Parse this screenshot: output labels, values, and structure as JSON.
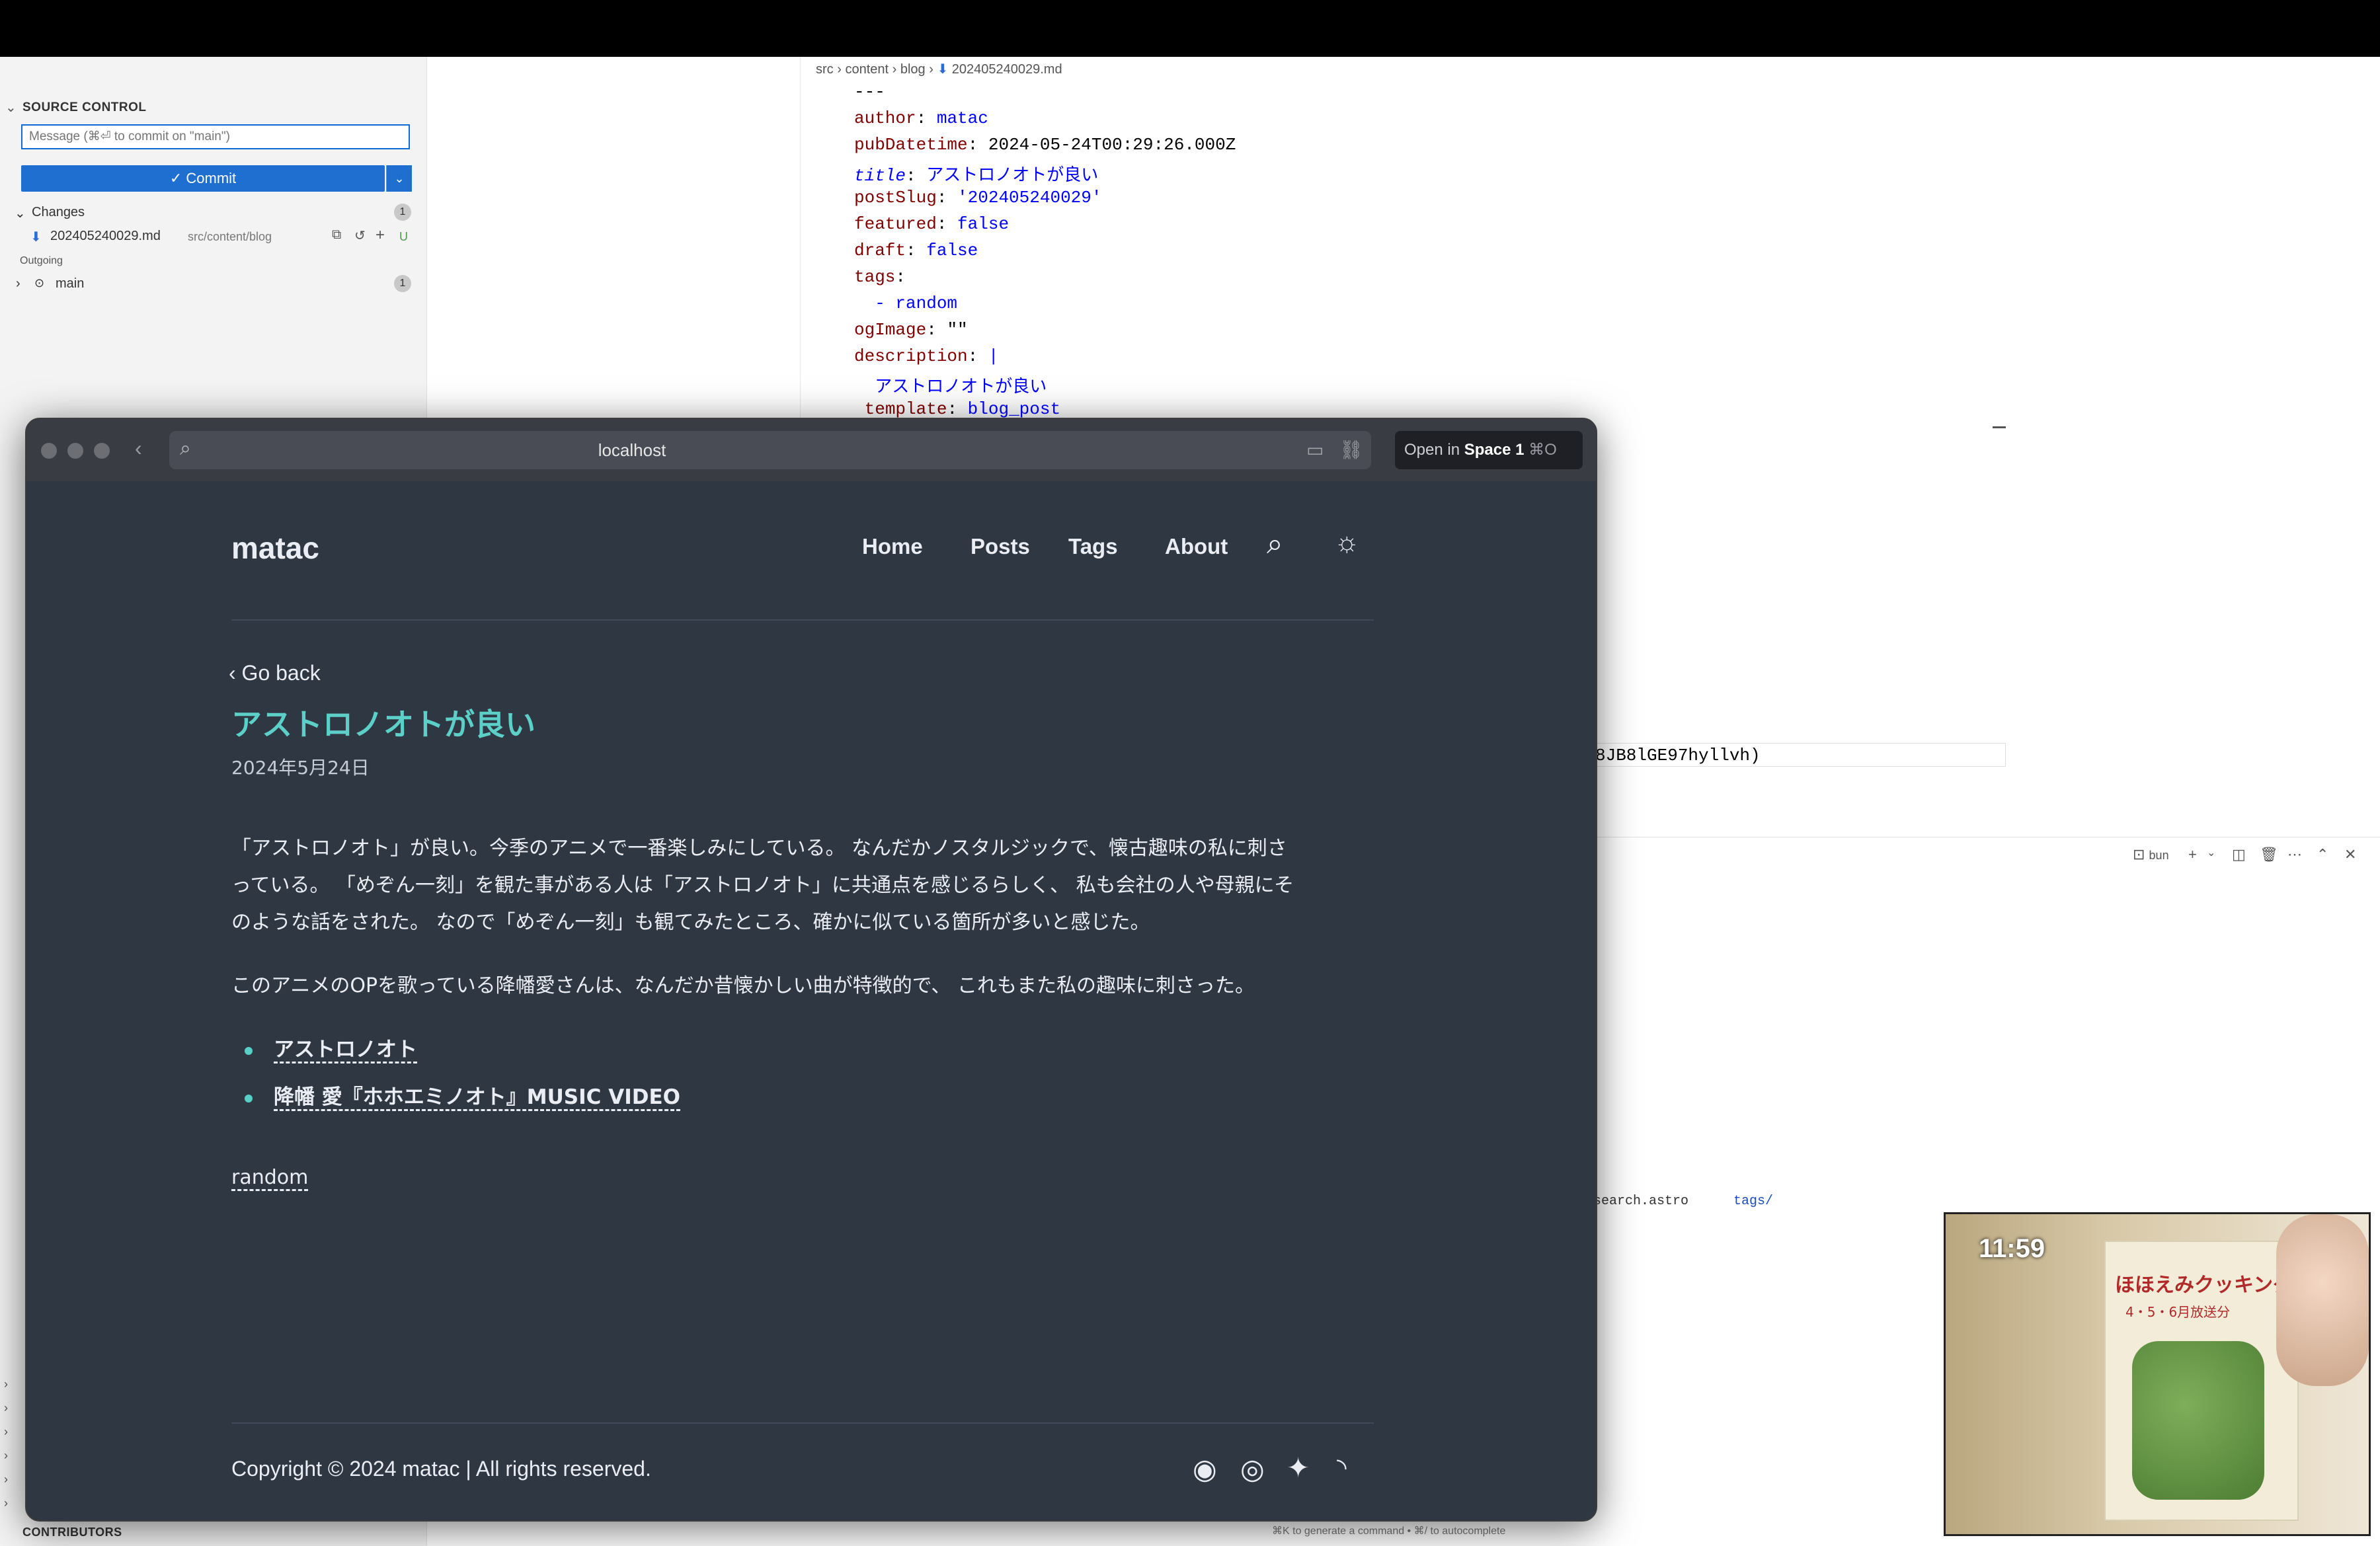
{
  "vscode": {
    "source_control": {
      "header": "SOURCE CONTROL",
      "message_placeholder": "Message (⌘⏎ to commit on \"main\")",
      "commit_label": "✓ Commit",
      "changes_label": "Changes",
      "changes_count": "1",
      "file_name": "202405240029.md",
      "file_path": "src/content/blog",
      "file_status": "U",
      "outgoing_label": "Outgoing",
      "branch": "main",
      "branch_count": "1",
      "contributors": "CONTRIBUTORS"
    },
    "breadcrumb": {
      "parts": [
        "src",
        "content",
        "blog",
        "202405240029.md"
      ]
    },
    "frontmatter": {
      "dashes": "---",
      "author_key": "author",
      "author_val": "matac",
      "pub_key": "pubDatetime",
      "pub_val": "2024-05-24T00:29:26.000Z",
      "title_key": "title",
      "title_val": "アストロノオトが良い",
      "slug_key": "postSlug",
      "slug_val": "'202405240029'",
      "featured_key": "featured",
      "featured_val": "false",
      "draft_key": "draft",
      "draft_val": "false",
      "tags_key": "tags",
      "tag_item": "- random",
      "og_key": "ogImage",
      "og_val": "\"\"",
      "desc_key": "description",
      "desc_pipe": "|",
      "desc_val": "アストロノオトが良い",
      "template_key": "template",
      "template_val": "blog_post"
    },
    "editor_tail": "8JB8lGE97hyllvh)",
    "terminal": {
      "shell_label": "bun",
      "file_a": "search.astro",
      "file_b": "tags/"
    },
    "status_hint": "⌘K to generate a command • ⌘/ to autocomplete"
  },
  "browser": {
    "url": "localhost",
    "open_in_prefix": "Open in",
    "open_in_space": "Space 1",
    "open_in_shortcut": "⌘O"
  },
  "site": {
    "logo": "matac",
    "nav": [
      "Home",
      "Posts",
      "Tags",
      "About"
    ],
    "go_back": "Go back",
    "title": "アストロノオトが良い",
    "date": "2024年5月24日",
    "para1_line1": "「アストロノオト」が良い。今季のアニメで一番楽しみにしている。 なんだかノスタルジックで、懐古趣味の私に刺さ",
    "para1_line2": "っている。 「めぞん一刻」を観た事がある人は「アストロノオト」に共通点を感じるらしく、 私も会社の人や母親にそ",
    "para1_line3": "のような話をされた。 なので「めぞん一刻」も観てみたところ、確かに似ている箇所が多いと感じた。",
    "para2": "このアニメのOPを歌っている降幡愛さんは、なんだか昔懐かしい曲が特徴的で、 これもまた私の趣味に刺さった。",
    "links": [
      "アストロノオト",
      "降幡 愛『ホホエミノオト』MUSIC VIDEO"
    ],
    "tag": "random",
    "footer": "Copyright © 2024 matac | All rights reserved.",
    "accent": "#5ccfc8",
    "bg": "#2f3742"
  },
  "video": {
    "time": "11:59",
    "book_title": "ほほえみクッキング",
    "book_sub": "4・5・6月放送分"
  }
}
